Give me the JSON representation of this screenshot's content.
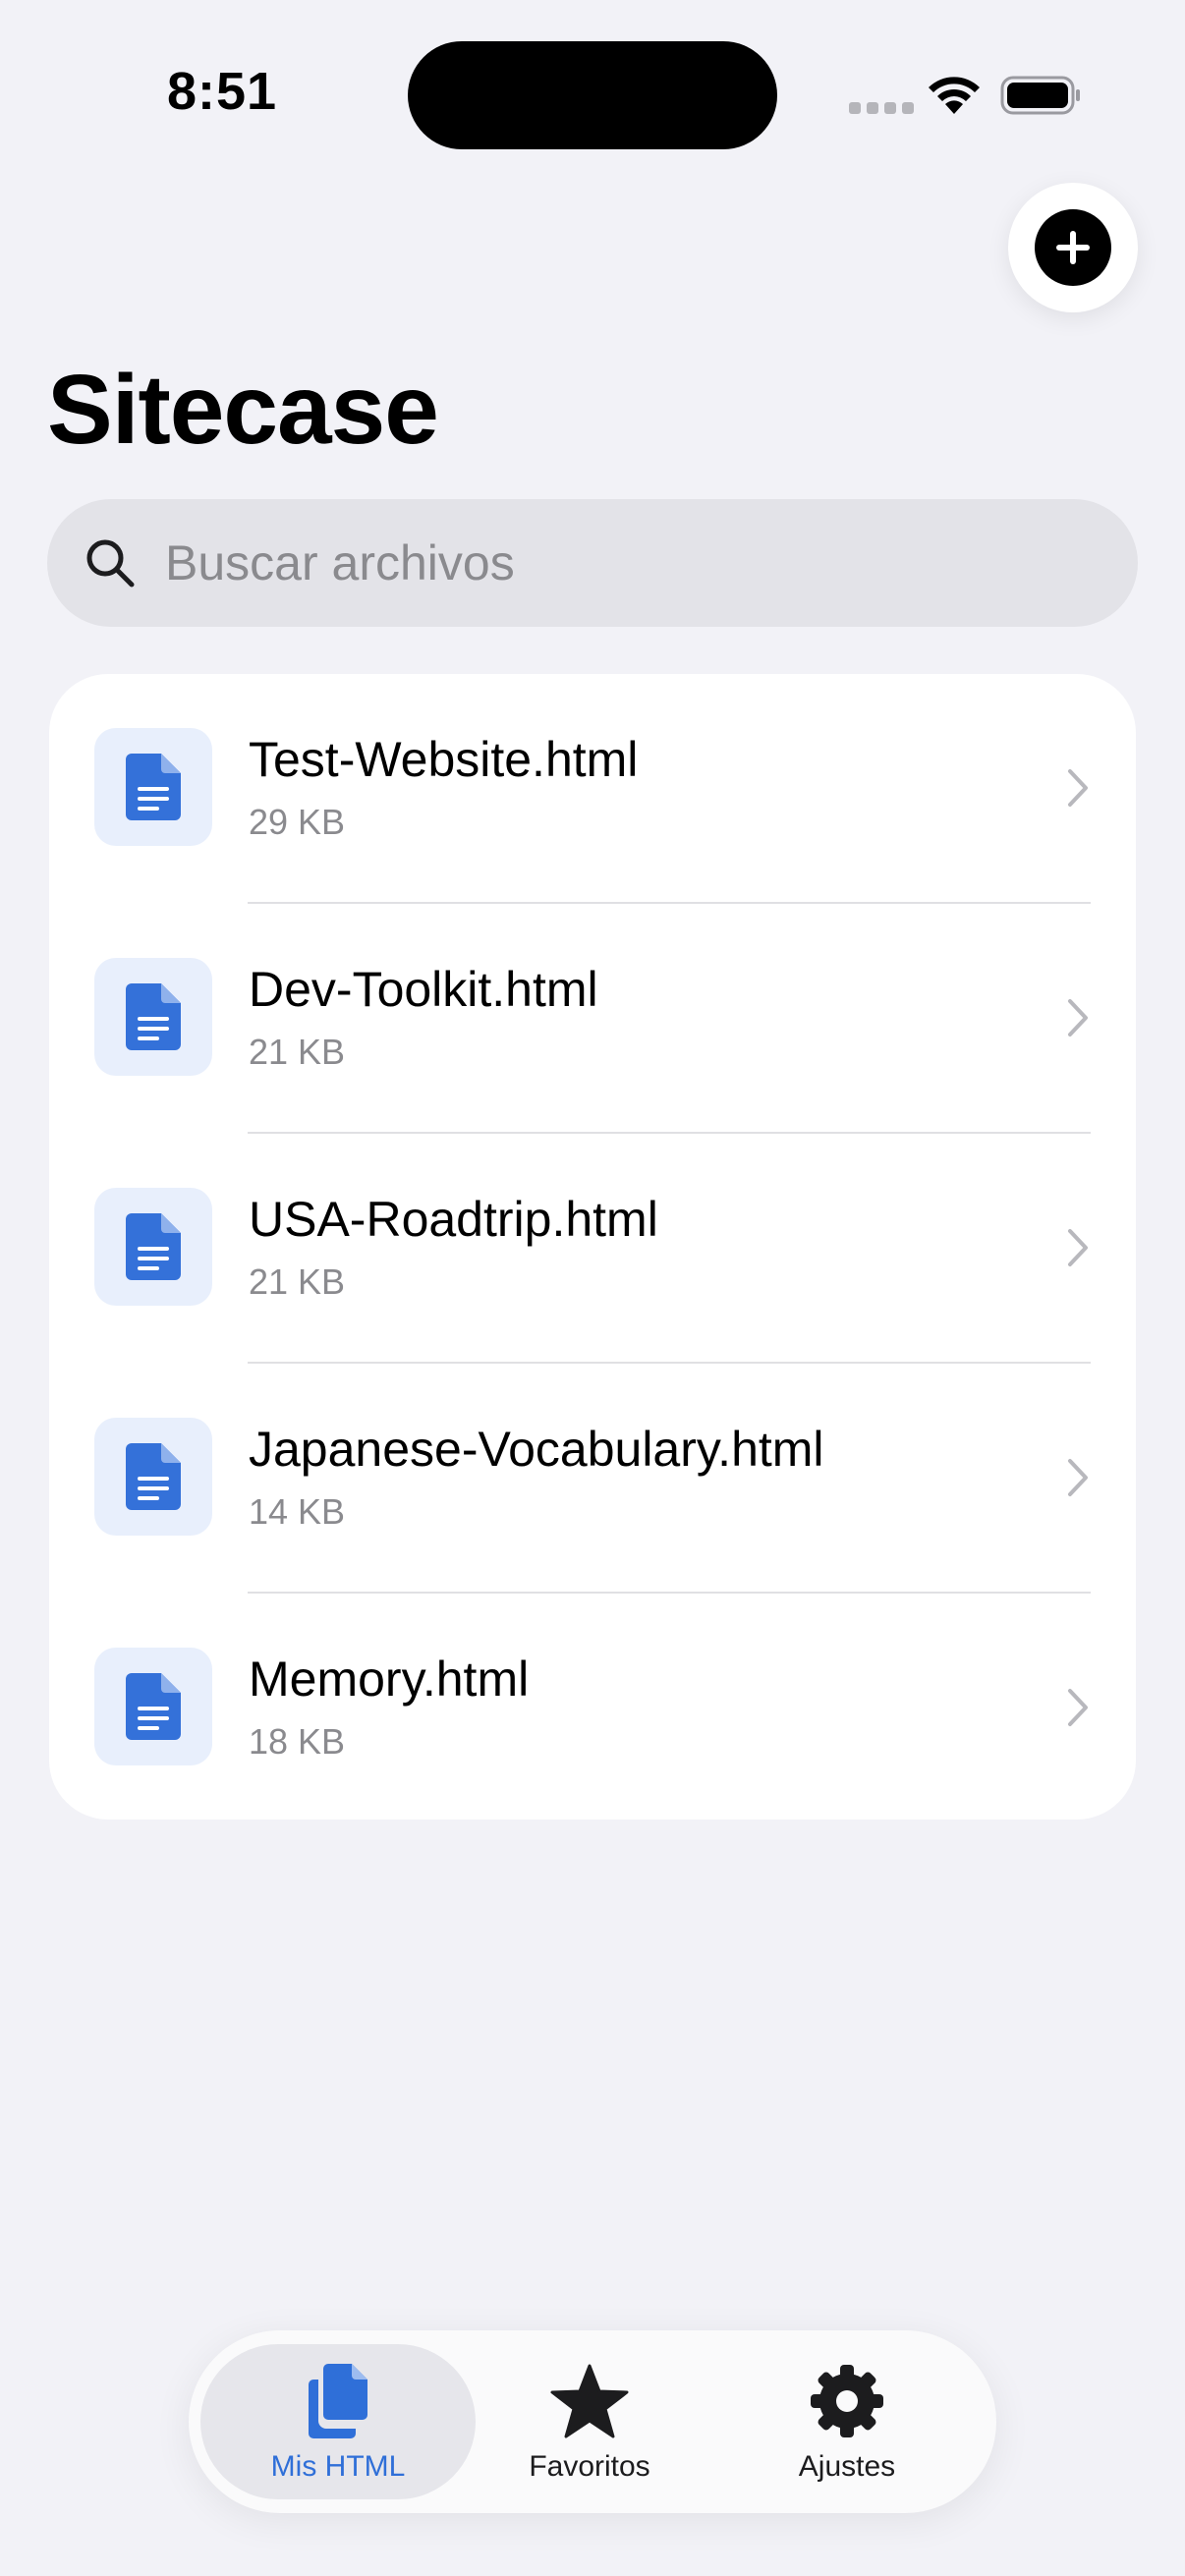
{
  "status_bar": {
    "time": "8:51"
  },
  "header": {
    "title": "Sitecase",
    "add_icon": "plus-circle-icon"
  },
  "search": {
    "placeholder": "Buscar archivos",
    "value": ""
  },
  "files": [
    {
      "name": "Test-Website.html",
      "size": "29 KB"
    },
    {
      "name": "Dev-Toolkit.html",
      "size": "21 KB"
    },
    {
      "name": "USA-Roadtrip.html",
      "size": "21 KB"
    },
    {
      "name": "Japanese-Vocabulary.html",
      "size": "14 KB"
    },
    {
      "name": "Memory.html",
      "size": "18 KB"
    }
  ],
  "tab_bar": {
    "tabs": [
      {
        "label": "Mis HTML",
        "icon": "documents-icon",
        "active": true
      },
      {
        "label": "Favoritos",
        "icon": "star-icon",
        "active": false
      },
      {
        "label": "Ajustes",
        "icon": "gear-icon",
        "active": false
      }
    ]
  },
  "colors": {
    "accent": "#2f6fd8",
    "background": "#f2f2f7",
    "file_thumb_bg": "#e8effc"
  }
}
